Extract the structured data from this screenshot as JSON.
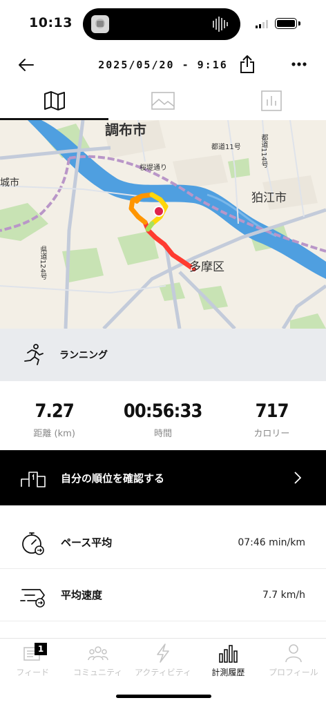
{
  "status_bar": {
    "time": "10:13"
  },
  "header": {
    "title": "2025/05/20 - 9:16",
    "back_icon": "arrow-left-icon",
    "share_icon": "share-icon",
    "more_icon": "more-dots-icon"
  },
  "tabs": [
    {
      "name": "map",
      "icon": "map-icon",
      "active": true
    },
    {
      "name": "photos",
      "icon": "image-icon",
      "active": false
    },
    {
      "name": "stats",
      "icon": "bar-chart-icon",
      "active": false
    }
  ],
  "map": {
    "labels": {
      "chofu": "調布市",
      "komae": "狛江市",
      "tama": "多摩区",
      "inagi_partial": "城市",
      "road_11": "都道11号",
      "road_114": "都道114号",
      "road_124": "県道124号",
      "sakura": "桜堤通り"
    },
    "route_colors": [
      "#ff3b30",
      "#ff9500",
      "#ffd60a",
      "#a8e05f"
    ]
  },
  "activity": {
    "icon": "running-person-icon",
    "label": "ランニング"
  },
  "stats": [
    {
      "value": "7.27",
      "label": "距離 (km)"
    },
    {
      "value": "00:56:33",
      "label": "時間"
    },
    {
      "value": "717",
      "label": "カロリー"
    }
  ],
  "rank": {
    "icon": "podium-icon",
    "label": "自分の順位を確認する"
  },
  "metrics": [
    {
      "icon": "stopwatch-icon",
      "label": "ペース平均",
      "value": "07:46 min/km"
    },
    {
      "icon": "speed-icon",
      "label": "平均速度",
      "value": "7.7 km/h"
    }
  ],
  "tab_bar": {
    "items": [
      {
        "icon": "feed-icon",
        "label": "フィード",
        "badge": "1",
        "active": false
      },
      {
        "icon": "community-icon",
        "label": "コミュニティ",
        "active": false
      },
      {
        "icon": "activity-bolt-icon",
        "label": "アクティビティ",
        "active": false
      },
      {
        "icon": "history-bars-icon",
        "label": "計測履歴",
        "active": true
      },
      {
        "icon": "profile-icon",
        "label": "プロフィール",
        "active": false
      }
    ]
  }
}
